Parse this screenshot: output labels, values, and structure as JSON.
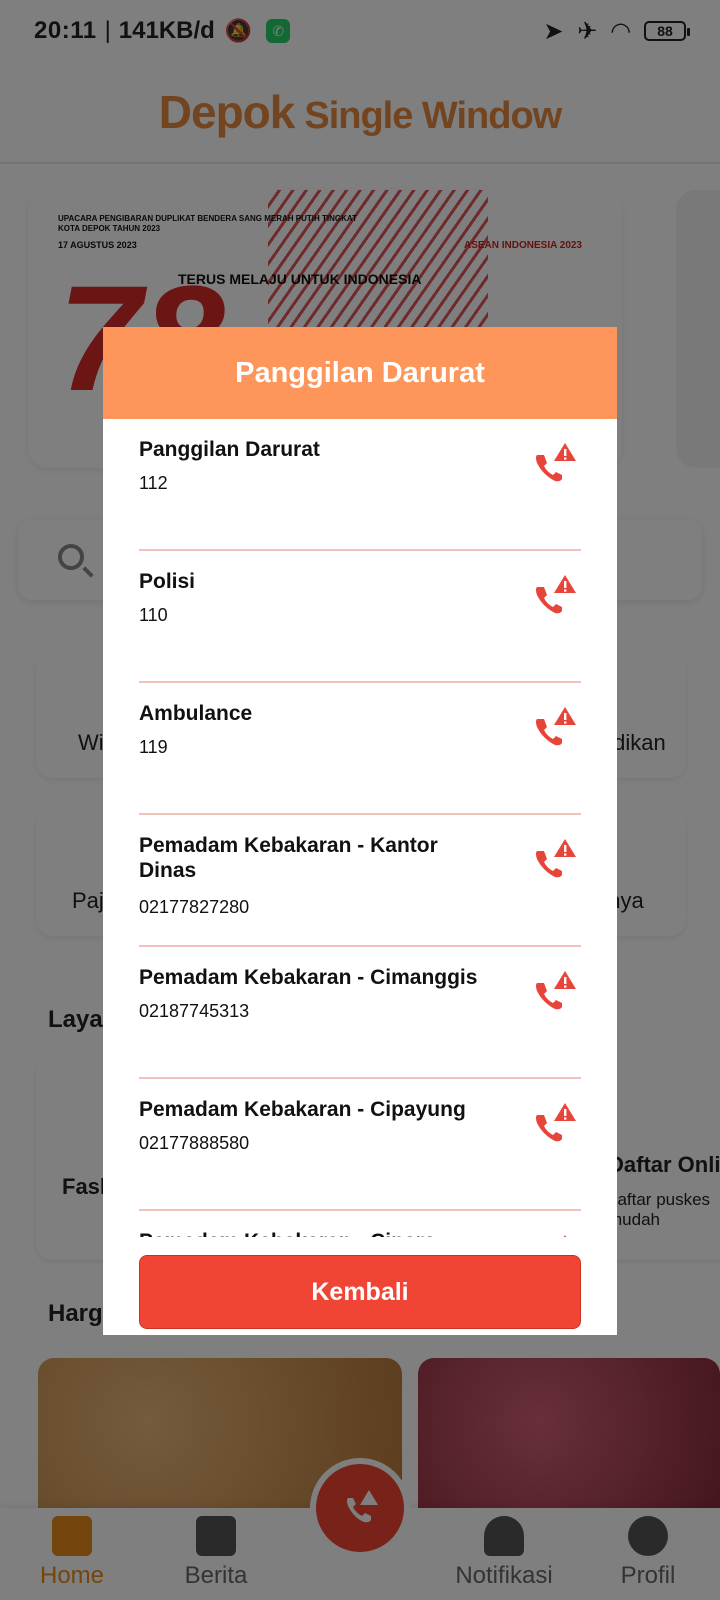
{
  "status_bar": {
    "time": "20:11",
    "data_rate": "141KB/d",
    "battery": "88"
  },
  "app": {
    "logo_part1": "Depok",
    "logo_part2": "Single Window"
  },
  "banner": {
    "line1": "UPACARA PENGIBARAN DUPLIKAT BENDERA SANG MERAH PUTIH TINGKAT KOTA DEPOK TAHUN 2023",
    "line2": "17 AGUSTUS 2023",
    "number": "78",
    "tagline": "TERUS MELAJU UNTUK INDONESIA",
    "asean": "ASEAN INDONESIA 2023"
  },
  "background_tiles": {
    "tile1": "Wi",
    "tile2": "didikan",
    "tile3": "Paj",
    "tile4": "nnya",
    "section1": "Laya",
    "card1": "Fask",
    "card2_title": "Daftar Onlin",
    "card2_sub": "daftar puskes mudah",
    "section2": "Harg"
  },
  "bottom_nav": {
    "home": "Home",
    "berita": "Berita",
    "notifikasi": "Notifikasi",
    "profil": "Profil"
  },
  "modal": {
    "title": "Panggilan Darurat",
    "contacts": [
      {
        "name": "Panggilan Darurat",
        "number": "112"
      },
      {
        "name": "Polisi",
        "number": "110"
      },
      {
        "name": "Ambulance",
        "number": "119"
      },
      {
        "name": "Pemadam Kebakaran - Kantor Dinas",
        "number": "02177827280"
      },
      {
        "name": "Pemadam Kebakaran - Cimanggis",
        "number": "02187745313"
      },
      {
        "name": "Pemadam Kebakaran - Cipayung",
        "number": "02177888580"
      },
      {
        "name": "Pemadam Kebakaran - Cinere",
        "number": ""
      }
    ],
    "back_label": "Kembali"
  },
  "colors": {
    "header": "#fe955a",
    "button": "#f04434",
    "call_icon": "#e8453a",
    "divider": "#f1c3b8",
    "accent": "#e88a1a"
  }
}
